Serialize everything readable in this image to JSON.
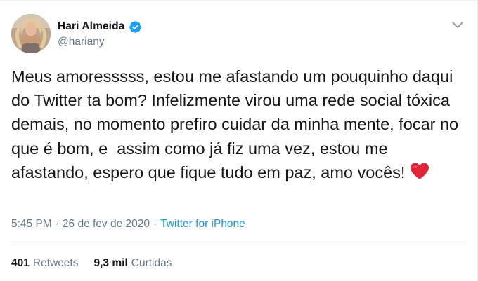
{
  "tweet": {
    "display_name": "Hari Almeida",
    "handle": "@hariany",
    "text": "Meus amoresssss, estou me afastando um pouquinho daqui do Twitter ta bom? Infelizmente virou uma rede social tóxica demais, no momento prefiro cuidar da minha mente, focar no que é bom, e  assim como já fiz uma vez, estou me afastando, espero que fique tudo em paz, amo vocês!",
    "time": "5:45 PM",
    "separator": "·",
    "date": "26 de fev de 2020",
    "source": "Twitter for iPhone"
  },
  "stats": {
    "retweets_count": "401",
    "retweets_label": "Retweets",
    "likes_count": "9,3 mil",
    "likes_label": "Curtidas"
  },
  "icons": {
    "verified": "verified-badge-icon",
    "heart": "red-heart-emoji-icon",
    "menu": "chevron-down-icon"
  },
  "colors": {
    "link": "#1b95e0",
    "secondary_text": "#657786",
    "primary_text": "#14171a",
    "verified": "#1da1f2",
    "heart": "#e0243a"
  }
}
